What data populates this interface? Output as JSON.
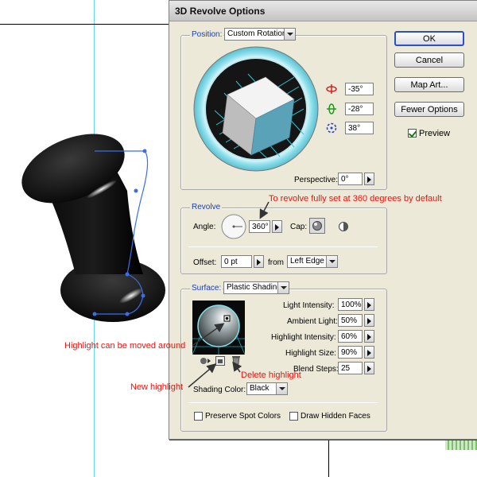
{
  "dialog": {
    "title": "3D Revolve Options",
    "buttons": {
      "ok": "OK",
      "cancel": "Cancel",
      "map_art": "Map Art...",
      "fewer_options": "Fewer Options"
    },
    "preview": {
      "label": "Preview",
      "checked": true
    }
  },
  "position": {
    "label": "Position:",
    "preset": "Custom Rotation",
    "rotation_x": "-35°",
    "rotation_y": "-28°",
    "rotation_z": "38°",
    "perspective_label": "Perspective:",
    "perspective_value": "0°"
  },
  "revolve": {
    "label": "Revolve",
    "angle_label": "Angle:",
    "angle_value": "360°",
    "cap_label": "Cap:",
    "offset_label": "Offset:",
    "offset_value": "0 pt",
    "from_label": "from",
    "from_value": "Left Edge"
  },
  "surface": {
    "label": "Surface:",
    "type": "Plastic Shading",
    "light_intensity_label": "Light Intensity:",
    "light_intensity": "100%",
    "ambient_light_label": "Ambient Light:",
    "ambient_light": "50%",
    "highlight_intensity_label": "Highlight Intensity:",
    "highlight_intensity": "60%",
    "highlight_size_label": "Highlight Size:",
    "highlight_size": "90%",
    "blend_steps_label": "Blend Steps:",
    "blend_steps": "25",
    "shading_color_label": "Shading Color:",
    "shading_color": "Black"
  },
  "options": {
    "preserve_spot_colors": "Preserve Spot Colors",
    "draw_hidden_faces": "Draw Hidden Faces"
  },
  "annotations": {
    "revolve_note": "To revolve fully set at 360 degrees by default",
    "highlight_moved": "Highlight can be moved around",
    "new_highlight": "New highlight",
    "delete_highlight": "Delete highlight"
  },
  "colors": {
    "annotation_red": "#e8140f",
    "group_label_blue": "#1a3fb5",
    "cube_face_blue": "#5aa2b8",
    "guide_cyan": "#66d9e8",
    "path_blue": "#3a6ee8"
  },
  "icons": {
    "rotate_x": "rotate-x-icon",
    "rotate_y": "rotate-y-icon",
    "rotate_z": "rotate-z-icon",
    "cap_on": "cap-on-icon",
    "cap_off": "cap-off-icon",
    "move_light_back": "move-light-back-icon",
    "new_light": "new-light-icon",
    "delete_light": "delete-light-icon"
  }
}
